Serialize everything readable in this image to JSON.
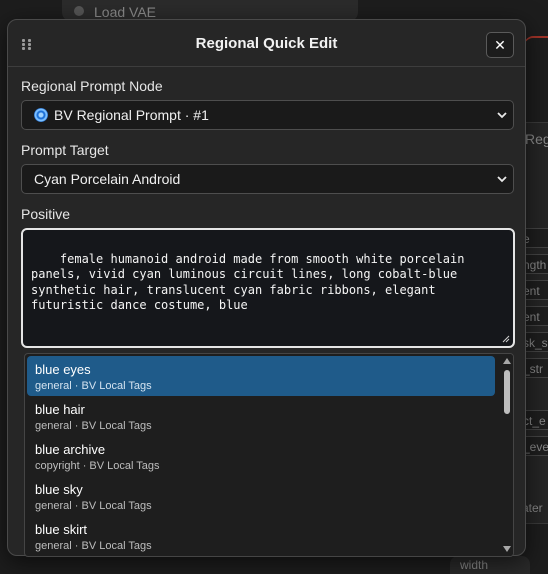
{
  "background": {
    "top_node_label": "Load VAE",
    "right_node_title": "Regio",
    "right_slots": [
      "e",
      "ngth",
      "ent",
      "ent",
      "sk_s",
      "_str",
      "ct_e",
      "_eve"
    ],
    "right_bottom_label": "ater",
    "bottom_widget_label": "width"
  },
  "modal": {
    "title": "Regional Quick Edit",
    "close_label": "✕",
    "node_label": "Regional Prompt Node",
    "node_value": "BV Regional Prompt · #1",
    "target_label": "Prompt Target",
    "target_value": "Cyan Porcelain Android",
    "positive_label": "Positive",
    "positive_text": "female humanoid android made from smooth white porcelain panels, vivid cyan luminous circuit lines, long cobalt-blue synthetic hair, translucent cyan fabric ribbons, elegant futuristic dance costume, blue"
  },
  "suggestions": [
    {
      "name": "blue eyes",
      "category": "general",
      "source": "BV Local Tags",
      "active": true
    },
    {
      "name": "blue hair",
      "category": "general",
      "source": "BV Local Tags",
      "active": false
    },
    {
      "name": "blue archive",
      "category": "copyright",
      "source": "BV Local Tags",
      "active": false
    },
    {
      "name": "blue sky",
      "category": "general",
      "source": "BV Local Tags",
      "active": false
    },
    {
      "name": "blue skirt",
      "category": "general",
      "source": "BV Local Tags",
      "active": false
    }
  ],
  "colors": {
    "accent_selected": "#1f5b8a",
    "modal_bg": "#262626",
    "wire": "#c0392b"
  }
}
